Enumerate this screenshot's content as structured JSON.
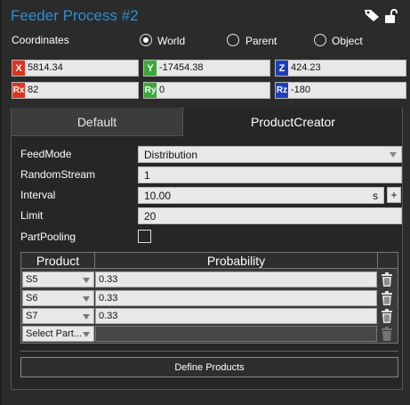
{
  "header": {
    "title": "Feeder Process #2",
    "icons": [
      "tag-icon",
      "unlock-icon"
    ]
  },
  "coordinates": {
    "label": "Coordinates",
    "options": [
      {
        "label": "World",
        "checked": true
      },
      {
        "label": "Parent",
        "checked": false
      },
      {
        "label": "Object",
        "checked": false
      }
    ]
  },
  "position": {
    "x": {
      "tag": "X",
      "value": "5814.34",
      "color": "#e0331f"
    },
    "y": {
      "tag": "Y",
      "value": "-17454.38",
      "color": "#3aa83a"
    },
    "z": {
      "tag": "Z",
      "value": "424.23",
      "color": "#1d3fb8"
    },
    "rx": {
      "tag": "Rx",
      "value": "82",
      "color": "#e0331f"
    },
    "ry": {
      "tag": "Ry",
      "value": "0",
      "color": "#3aa83a"
    },
    "rz": {
      "tag": "Rz",
      "value": "-180",
      "color": "#1d3fb8"
    }
  },
  "tabs": [
    {
      "label": "Default",
      "active": false
    },
    {
      "label": "ProductCreator",
      "active": true
    }
  ],
  "properties": {
    "feed_mode": {
      "label": "FeedMode",
      "value": "Distribution"
    },
    "random_stream": {
      "label": "RandomStream",
      "value": "1"
    },
    "interval": {
      "label": "Interval",
      "value": "10.00",
      "unit": "s",
      "add_label": "+"
    },
    "limit": {
      "label": "Limit",
      "value": "20"
    },
    "part_pooling": {
      "label": "PartPooling",
      "checked": false
    }
  },
  "table": {
    "headers": [
      "Product",
      "Probability"
    ],
    "rows": [
      {
        "product": "S5",
        "probability": "0.33"
      },
      {
        "product": "S6",
        "probability": "0.33"
      },
      {
        "product": "S7",
        "probability": "0.33"
      }
    ],
    "new_row": {
      "product": "Select Part...",
      "probability": ""
    }
  },
  "actions": {
    "define_products": "Define Products"
  },
  "colors": {
    "accent": "#2a8fd6",
    "background": "#2b2b2b"
  }
}
